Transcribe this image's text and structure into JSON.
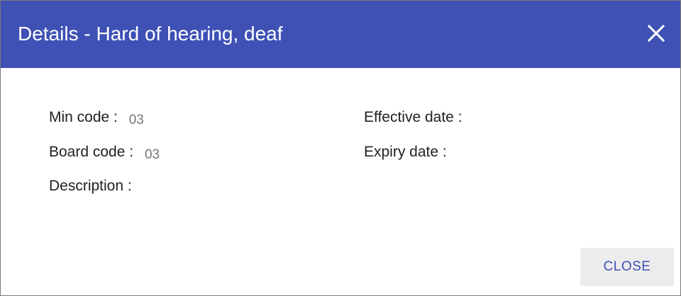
{
  "dialog": {
    "title": "Details - Hard of hearing, deaf",
    "close_icon": "close-icon",
    "header_color": "#3f51b5"
  },
  "fields": {
    "min_code": {
      "label": "Min code :",
      "value": "03"
    },
    "board_code": {
      "label": "Board code :",
      "value": "03"
    },
    "description": {
      "label": "Description :",
      "value": ""
    },
    "effective_date": {
      "label": "Effective date :",
      "value": ""
    },
    "expiry_date": {
      "label": "Expiry date :",
      "value": ""
    }
  },
  "footer": {
    "close_label": "CLOSE"
  }
}
